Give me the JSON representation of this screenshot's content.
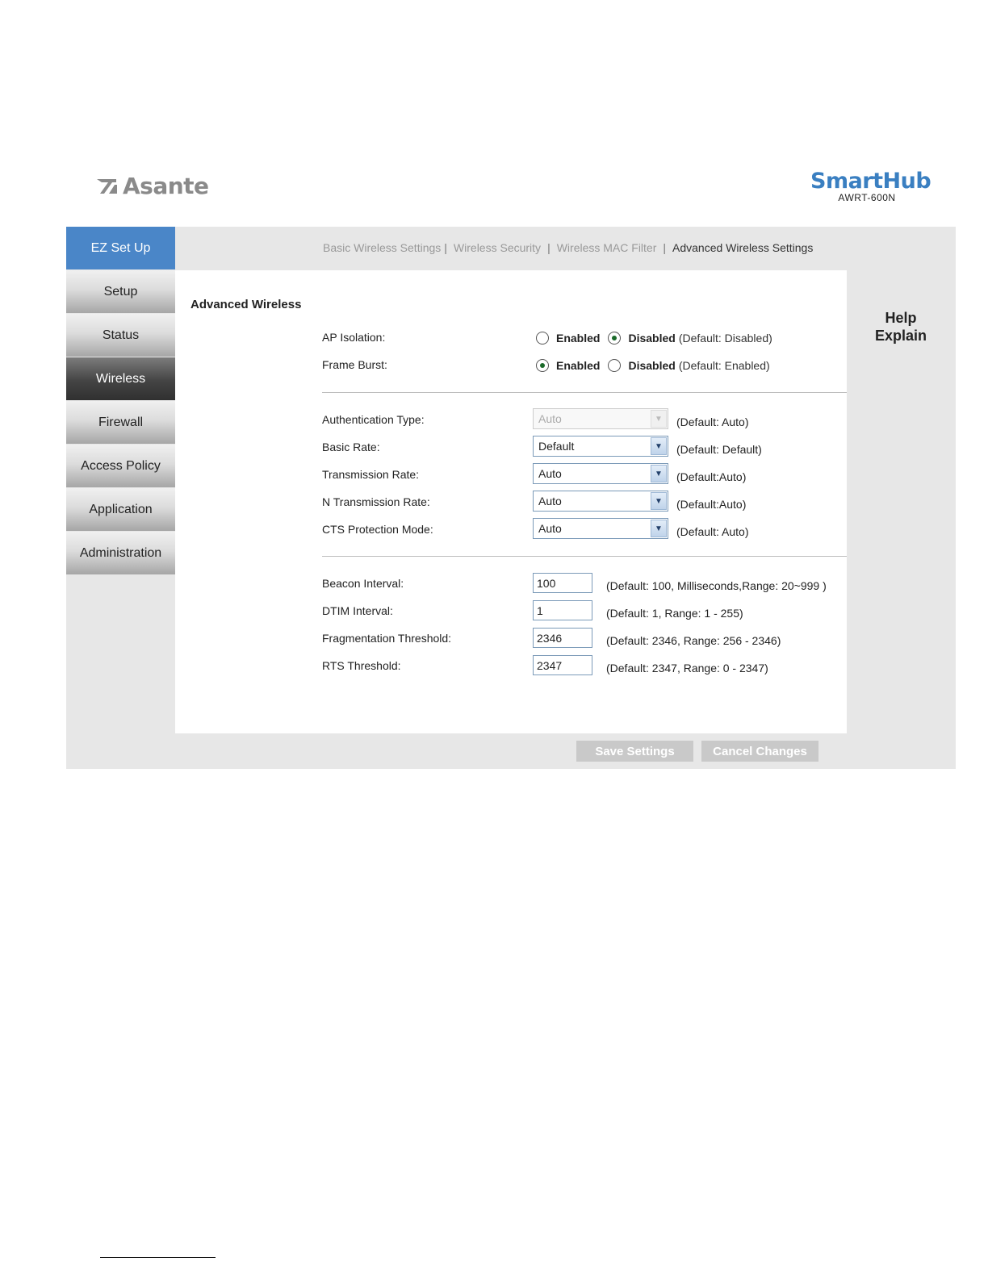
{
  "header": {
    "logo_text": "Asante",
    "brand_name": "SmartHub",
    "brand_model": "AWRT-600N"
  },
  "sidebar": {
    "items": [
      {
        "label": "EZ Set Up"
      },
      {
        "label": "Setup"
      },
      {
        "label": "Status"
      },
      {
        "label": "Wireless"
      },
      {
        "label": "Firewall"
      },
      {
        "label": "Access Policy"
      },
      {
        "label": "Application"
      },
      {
        "label": "Administration"
      }
    ],
    "active": "Wireless"
  },
  "tabs": {
    "items": [
      {
        "label": "Basic Wireless Settings"
      },
      {
        "label": "Wireless Security"
      },
      {
        "label": "Wireless MAC Filter"
      },
      {
        "label": "Advanced Wireless Settings"
      }
    ],
    "separators": [
      "|",
      "|",
      "|"
    ],
    "current": "Advanced Wireless Settings"
  },
  "section_title": "Advanced Wireless",
  "radios": {
    "enabled_label": "Enabled",
    "disabled_label": "Disabled",
    "ap_isolation": {
      "label": "AP Isolation:",
      "selected": "Disabled",
      "default": "(Default: Disabled)"
    },
    "frame_burst": {
      "label": "Frame Burst:",
      "selected": "Enabled",
      "default": "(Default: Enabled)"
    }
  },
  "selects": {
    "auth_type": {
      "label": "Authentication Type:",
      "value": "Auto",
      "default": "(Default: Auto)",
      "disabled": true
    },
    "basic_rate": {
      "label": "Basic Rate:",
      "value": "Default",
      "default": "(Default: Default)"
    },
    "transmission_rate": {
      "label": "Transmission Rate:",
      "value": "Auto",
      "default": "(Default:Auto)"
    },
    "n_transmission_rate": {
      "label": "N Transmission Rate:",
      "value": "Auto",
      "default": "(Default:Auto)"
    },
    "cts_protection": {
      "label": "CTS Protection Mode:",
      "value": "Auto",
      "default": "(Default: Auto)"
    }
  },
  "inputs": {
    "beacon_interval": {
      "label": "Beacon Interval:",
      "value": "100",
      "default": "(Default: 100, Milliseconds,Range: 20~999 )"
    },
    "dtim_interval": {
      "label": "DTIM Interval:",
      "value": "1",
      "default": "(Default: 1, Range: 1 - 255)"
    },
    "fragmentation_threshold": {
      "label": "Fragmentation Threshold:",
      "value": "2346",
      "default": "(Default: 2346, Range: 256 - 2346)"
    },
    "rts_threshold": {
      "label": "RTS Threshold:",
      "value": "2347",
      "default": "(Default: 2347, Range: 0 - 2347)"
    }
  },
  "help": {
    "line1": "Help",
    "line2": "Explain"
  },
  "buttons": {
    "save": "Save Settings",
    "cancel": "Cancel Changes"
  },
  "colors": {
    "ez_setup": "#4a86c8",
    "brand": "#3a7fc1",
    "frame": "#e7e7e7",
    "button": "#c9c9c9"
  }
}
